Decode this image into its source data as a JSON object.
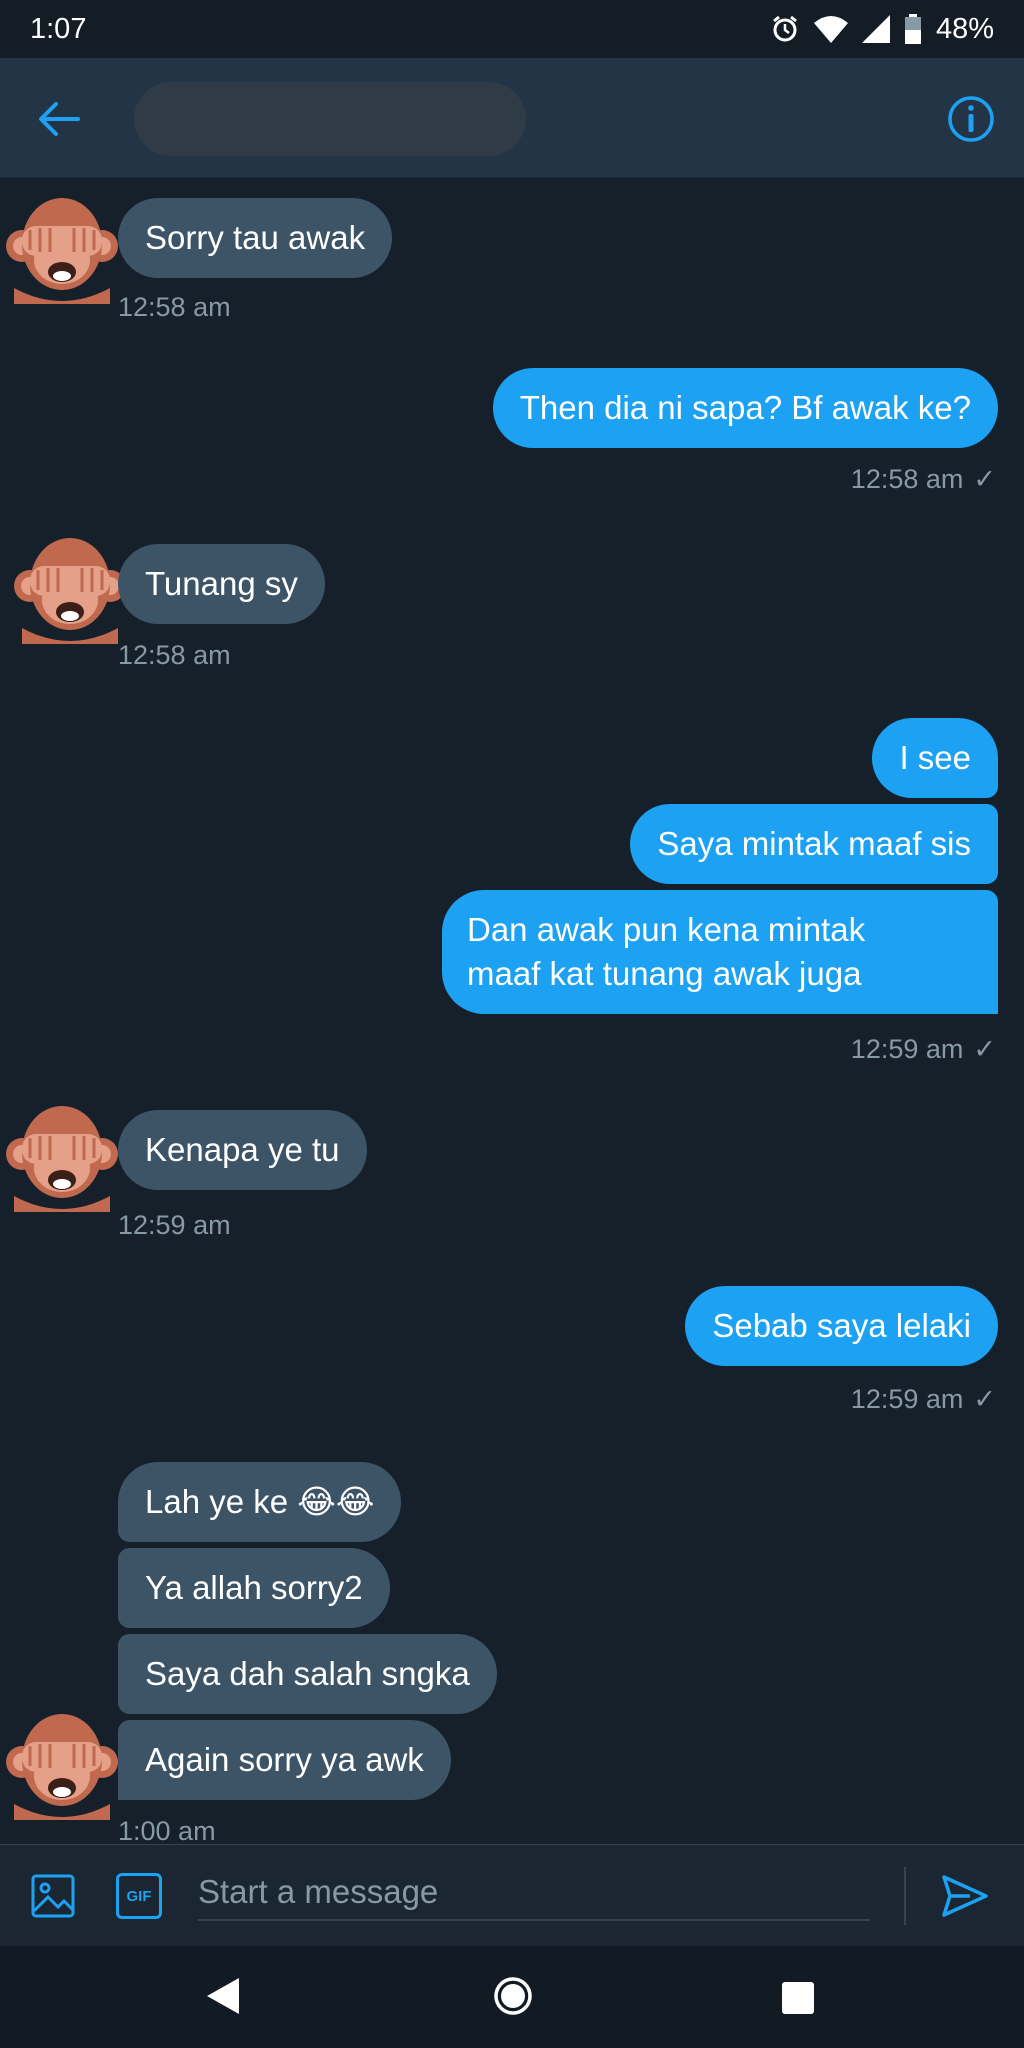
{
  "status_bar": {
    "time": "1:07",
    "battery": "48%"
  },
  "header": {
    "back_icon": "arrow-left-icon",
    "info_icon": "info-icon"
  },
  "messages": [
    {
      "text": "Sorry tau awak",
      "time": "12:58 am"
    },
    {
      "text": "Then dia ni sapa? Bf awak ke?",
      "time": "12:58 am",
      "check": "✓"
    },
    {
      "text": "Tunang sy",
      "time": "12:58 am"
    },
    {
      "text": "I see"
    },
    {
      "text": "Saya mintak maaf sis"
    },
    {
      "line1": "Dan awak pun kena mintak",
      "line2": "maaf kat tunang awak juga",
      "time": "12:59 am",
      "check": "✓"
    },
    {
      "text": "Kenapa ye tu",
      "time": "12:59 am"
    },
    {
      "text": "Sebab saya lelaki",
      "time": "12:59 am",
      "check": "✓"
    },
    {
      "text": "Lah ye ke 😂😂"
    },
    {
      "text": "Ya allah sorry2"
    },
    {
      "text": "Saya dah salah sngka"
    },
    {
      "text": "Again sorry ya awk",
      "time": "1:00 am"
    }
  ],
  "composer": {
    "placeholder": "Start a message",
    "gif_label": "GIF"
  },
  "colors": {
    "background": "#15202b",
    "header": "#243447",
    "incoming": "#3d5466",
    "outgoing": "#1da1f2",
    "accent": "#1da1f2",
    "muted": "#8899a6"
  }
}
